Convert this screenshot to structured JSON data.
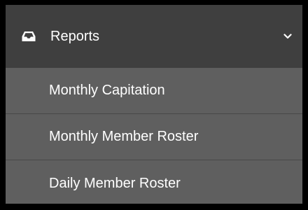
{
  "menu": {
    "header": {
      "icon": "inbox-icon",
      "label": "Reports",
      "chevron_icon": "chevron-down-icon"
    },
    "items": [
      {
        "label": "Monthly Capitation"
      },
      {
        "label": "Monthly Member Roster"
      },
      {
        "label": "Daily Member Roster"
      }
    ]
  },
  "colors": {
    "background": "#000000",
    "header_bg": "#3f3f3f",
    "item_bg": "#5f5f5f",
    "divider": "#484848",
    "text": "#ffffff"
  }
}
